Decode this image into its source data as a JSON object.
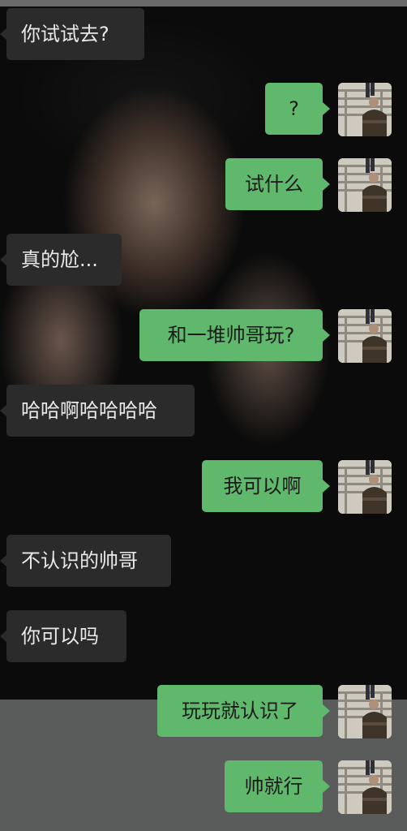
{
  "chat": {
    "messages": [
      {
        "side": "incoming",
        "text": "你试试去?"
      },
      {
        "side": "outgoing",
        "text": "?"
      },
      {
        "side": "outgoing",
        "text": "试什么"
      },
      {
        "side": "incoming",
        "text": "真的尬..."
      },
      {
        "side": "outgoing",
        "text": "和一堆帅哥玩?"
      },
      {
        "side": "incoming",
        "text": "哈哈啊哈哈哈哈"
      },
      {
        "side": "outgoing",
        "text": "我可以啊"
      },
      {
        "side": "incoming",
        "text": "不认识的帅哥"
      },
      {
        "side": "incoming",
        "text": "你可以吗"
      },
      {
        "side": "outgoing",
        "text": "玩玩就认识了"
      },
      {
        "side": "outgoing",
        "text": "帅就行"
      }
    ]
  },
  "colors": {
    "incoming_bubble": "#2b2b2b",
    "outgoing_bubble": "#5fb86c",
    "wallpaper": "#0a0a0a"
  },
  "icons": {
    "my_avatar": "user-avatar-photo"
  }
}
